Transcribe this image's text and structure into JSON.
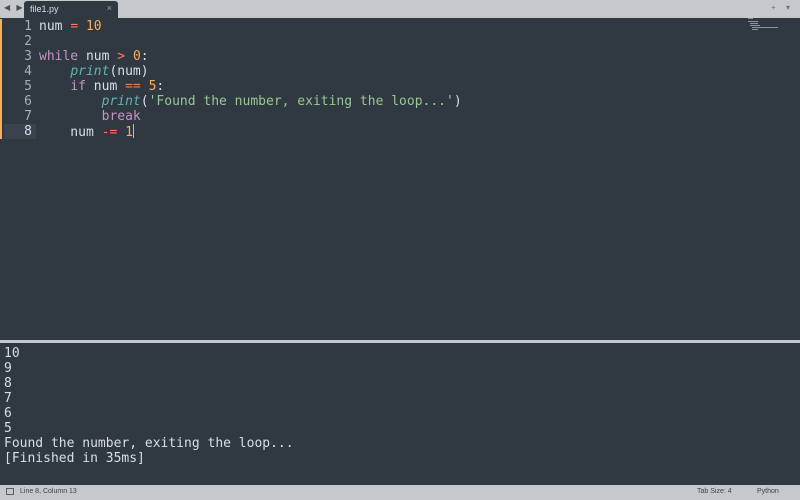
{
  "tabbar": {
    "nav_arrows": "◀ ▶",
    "active_tab": "file1.py",
    "close_glyph": "×",
    "right_controls": "+ ▾"
  },
  "editor": {
    "lines": [
      {
        "n": "1",
        "tokens": [
          {
            "t": "num",
            "c": ""
          },
          {
            "t": " ",
            "c": ""
          },
          {
            "t": "=",
            "c": "op"
          },
          {
            "t": " ",
            "c": ""
          },
          {
            "t": "10",
            "c": "num"
          }
        ]
      },
      {
        "n": "2",
        "tokens": []
      },
      {
        "n": "3",
        "tokens": [
          {
            "t": "while",
            "c": "kw"
          },
          {
            "t": " num ",
            "c": ""
          },
          {
            "t": ">",
            "c": "op"
          },
          {
            "t": " ",
            "c": ""
          },
          {
            "t": "0",
            "c": "num"
          },
          {
            "t": ":",
            "c": ""
          }
        ]
      },
      {
        "n": "4",
        "tokens": [
          {
            "t": "    ",
            "c": ""
          },
          {
            "t": "print",
            "c": "fn"
          },
          {
            "t": "(num)",
            "c": ""
          }
        ]
      },
      {
        "n": "5",
        "tokens": [
          {
            "t": "    ",
            "c": ""
          },
          {
            "t": "if",
            "c": "kw"
          },
          {
            "t": " num ",
            "c": ""
          },
          {
            "t": "==",
            "c": "op"
          },
          {
            "t": " ",
            "c": ""
          },
          {
            "t": "5",
            "c": "num"
          },
          {
            "t": ":",
            "c": ""
          }
        ]
      },
      {
        "n": "6",
        "tokens": [
          {
            "t": "        ",
            "c": ""
          },
          {
            "t": "print",
            "c": "fn"
          },
          {
            "t": "(",
            "c": ""
          },
          {
            "t": "'Found the number, exiting the loop...'",
            "c": "str"
          },
          {
            "t": ")",
            "c": ""
          }
        ]
      },
      {
        "n": "7",
        "tokens": [
          {
            "t": "        ",
            "c": ""
          },
          {
            "t": "break",
            "c": "kw"
          }
        ]
      },
      {
        "n": "8",
        "tokens": [
          {
            "t": "    num ",
            "c": ""
          },
          {
            "t": "-=",
            "c": "op"
          },
          {
            "t": " ",
            "c": ""
          },
          {
            "t": "1",
            "c": "num"
          }
        ]
      }
    ],
    "current_line": "8",
    "modified_lines": [
      "1",
      "2",
      "3",
      "4",
      "5",
      "6",
      "7",
      "8"
    ]
  },
  "output": {
    "lines": [
      "10",
      "9",
      "8",
      "7",
      "6",
      "5",
      "Found the number, exiting the loop...",
      "[Finished in 35ms]"
    ]
  },
  "statusbar": {
    "position": "Line 8, Column 13",
    "tab_size": "Tab Size: 4",
    "syntax": "Python"
  },
  "colors": {
    "background": "#303841",
    "keyword": "#c594c5",
    "operator": "#f97b58",
    "number": "#f9ae58",
    "string": "#99c794",
    "function": "#5fb4b4",
    "text": "#d8dee9"
  }
}
